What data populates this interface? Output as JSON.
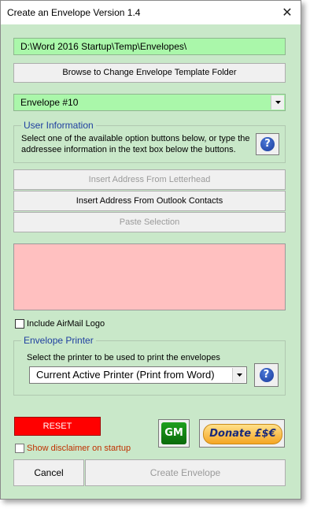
{
  "window": {
    "title": "Create an Envelope Version 1.4",
    "close_glyph": "✕"
  },
  "folder_path": "D:\\Word 2016 Startup\\Temp\\Envelopes\\",
  "browse_button": "Browse to Change Envelope Template Folder",
  "envelope_select": {
    "value": "Envelope #10"
  },
  "user_info": {
    "legend": "User Information",
    "description": "Select one of the available option buttons below, or type the addressee information in the text box below the buttons.",
    "help_glyph": "?"
  },
  "address_buttons": {
    "letterhead": "Insert Address From Letterhead",
    "outlook": "Insert Address From Outlook Contacts",
    "paste": "Paste Selection"
  },
  "address_box": {
    "value": ""
  },
  "airmail": {
    "label": "Include AirMail Logo",
    "checked": false
  },
  "printer": {
    "legend": "Envelope Printer",
    "description": "Select the printer to be used to print the envelopes",
    "value": "Current Active Printer (Print from Word)",
    "help_glyph": "?"
  },
  "reset_button": "RESET",
  "gm_button": "GM",
  "donate_button": "Donate £$€",
  "disclaimer": {
    "label": "Show disclaimer on startup",
    "checked": false
  },
  "cancel_button": "Cancel",
  "create_button": "Create Envelope",
  "colors": {
    "background": "#c9e8c9",
    "field": "#aaf7aa",
    "address_box": "#ffc0c0",
    "reset": "#ff0000",
    "legend": "#1f3fa0",
    "disclaimer_text": "#c03000"
  }
}
